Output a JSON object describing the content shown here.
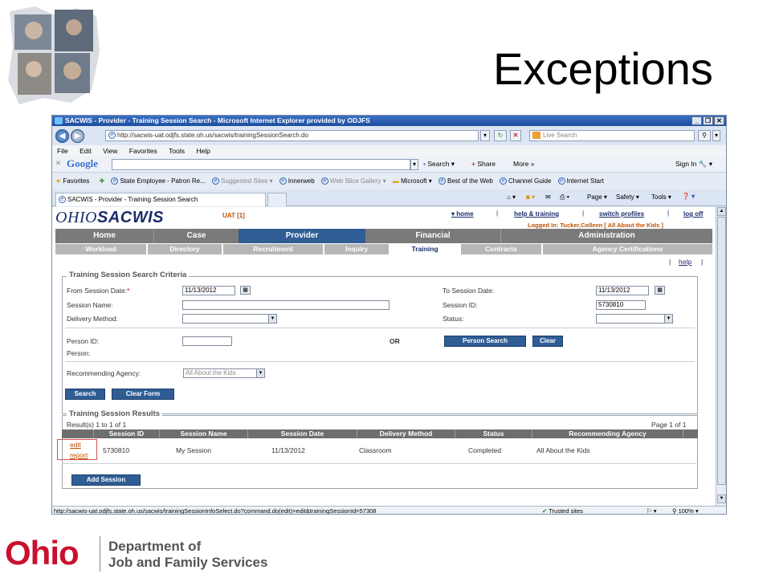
{
  "slide": {
    "title": "Exceptions"
  },
  "window": {
    "title": "SACWIS - Provider - Training Session Search - Microsoft Internet Explorer provided by ODJFS"
  },
  "addressbar": {
    "url": "http://sacwis-uat.odjfs.state.oh.us/sacwis/trainingSessionSearch.do",
    "search_placeholder": "Live Search"
  },
  "menubar": [
    "File",
    "Edit",
    "View",
    "Favorites",
    "Tools",
    "Help"
  ],
  "googlebar": {
    "brand": "Google",
    "search": "Search",
    "share": "Share",
    "more": "More",
    "signin": "Sign In"
  },
  "favbar": {
    "label": "Favorites",
    "items": [
      "State Employee - Patron Re...",
      "Suggested Sites",
      "Innerweb",
      "Web Slice Gallery",
      "Microsoft",
      "Best of the Web",
      "Channel Guide",
      "Internet Start"
    ]
  },
  "tabbar": {
    "tab_title": "SACWIS - Provider - Training Session Search",
    "page": "Page",
    "safety": "Safety",
    "tools": "Tools"
  },
  "sacwis": {
    "logo_prefix": "OHIO",
    "logo_suffix": "SACWIS",
    "env": "UAT [1]",
    "links": {
      "home": "home",
      "help_training": "help & training",
      "switch_profiles": "switch profiles",
      "log_off": "log off"
    },
    "logged_in": "Logged In:  Tucker,Colleen [ All About the Kids ]",
    "main_tabs": [
      "Home",
      "Case",
      "Provider",
      "Financial",
      "Administration"
    ],
    "sub_tabs": [
      "Workload",
      "Directory",
      "Recruitment",
      "Inquiry",
      "Training",
      "Contracts",
      "Agency Certifications"
    ],
    "help": "help"
  },
  "criteria": {
    "legend": "Training Session Search Criteria",
    "from_label": "From Session Date:",
    "required_mark": "*",
    "from_value": "11/13/2012",
    "to_label": "To Session Date:",
    "to_value": "11/13/2012",
    "name_label": "Session Name:",
    "name_value": "",
    "id_label": "Session ID:",
    "id_value": "5730810",
    "delivery_label": "Delivery Method:",
    "status_label": "Status:",
    "person_id_label": "Person ID:",
    "or_text": "OR",
    "person_search_btn": "Person Search",
    "clear_btn": "Clear",
    "person_label": "Person:",
    "agency_label": "Recommending Agency:",
    "agency_value": "All About the Kids",
    "search_btn": "Search",
    "clear_form_btn": "Clear Form"
  },
  "results": {
    "legend": "Training Session Results",
    "count": "Result(s) 1 to 1 of 1",
    "page": "Page 1 of 1",
    "columns": [
      "Session ID",
      "Session Name",
      "Session Date",
      "Delivery Method",
      "Status",
      "Recommending Agency"
    ],
    "row": {
      "edit": "edit",
      "report": "report",
      "session_id": "5730810",
      "session_name": "My Session",
      "session_date": "11/13/2012",
      "delivery_method": "Classroom",
      "status": "Completed",
      "agency": "All About the Kids"
    },
    "add_btn": "Add Session"
  },
  "statusbar": {
    "url": "http://sacwis-uat.odjfs.state.oh.us/sacwis/trainingSessionInfoSelect.do?command.do(edit)=edit&trainingSessionId=57308",
    "trusted": "Trusted sites",
    "zoom": "100%"
  },
  "footer": {
    "ohio": "Ohio",
    "dept_line1": "Department of",
    "dept_line2": "Job and Family Services"
  },
  "colors": {
    "accent": "#2f5d94",
    "tab_gray": "#7a7a7a",
    "link_orange": "#c05000",
    "ohio_red": "#c8102e"
  }
}
